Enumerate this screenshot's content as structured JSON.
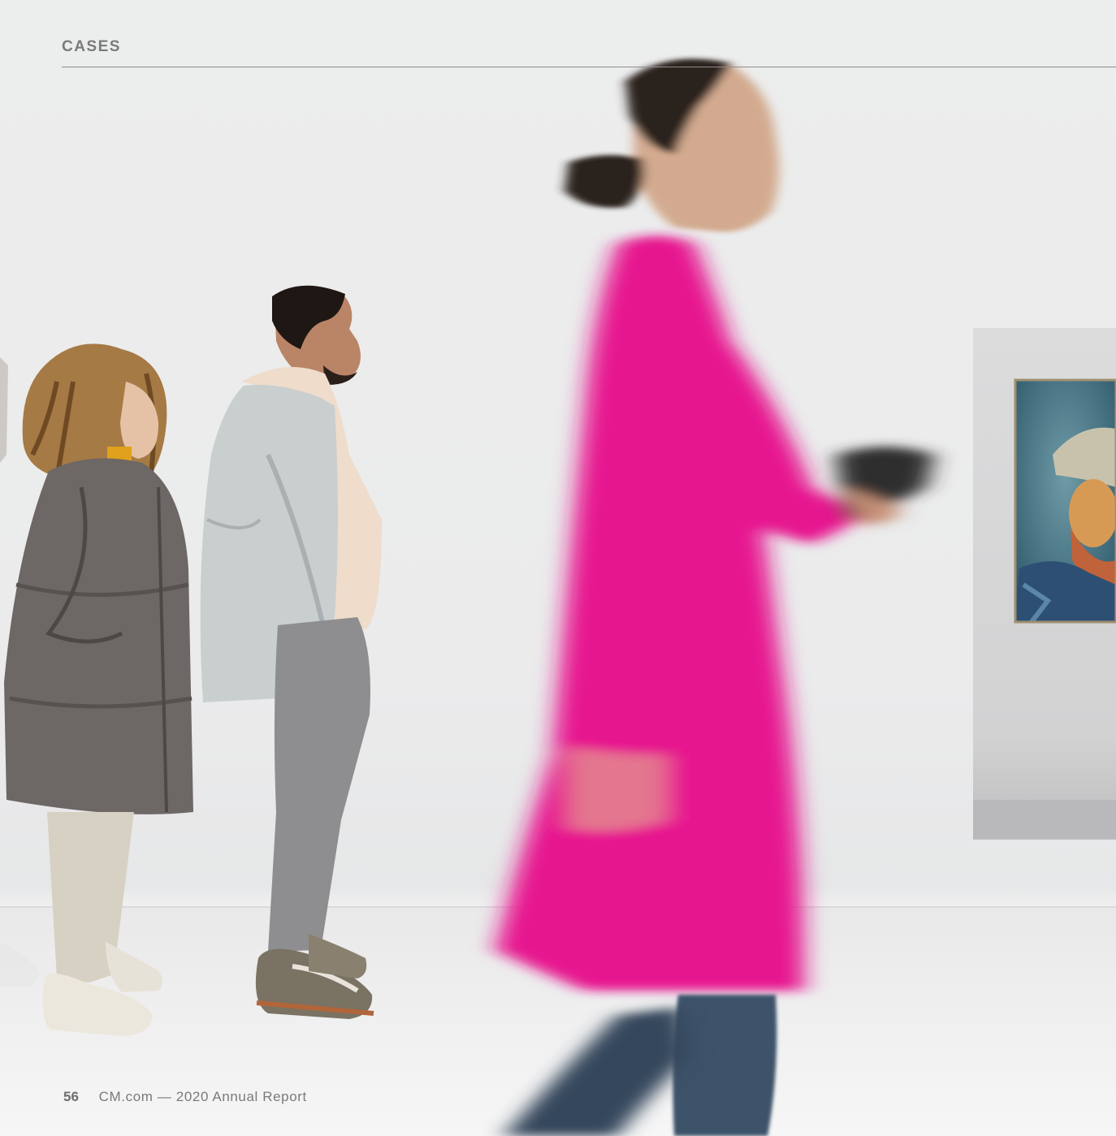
{
  "header": {
    "section_label": "CASES"
  },
  "footer": {
    "page_number": "56",
    "report_title": "CM.com — 2020 Annual Report"
  },
  "photo": {
    "subjects": [
      "visitor-woman-grey-coat",
      "visitor-man-light-jacket",
      "visitor-woman-pink-coat-walking",
      "framed-portrait-painting"
    ],
    "colors": {
      "background": "#ececed",
      "floor": "#f3f3f3",
      "pink_coat": "#e6168f",
      "grey_coat": "#6d6765",
      "light_jacket": "#c9cecf",
      "hoodie": "#efdccb",
      "jeans": "#3e536b",
      "trousers": "#8e8e90",
      "painting_blue": "#4b7a8c",
      "painting_orange": "#c98a3c"
    }
  }
}
